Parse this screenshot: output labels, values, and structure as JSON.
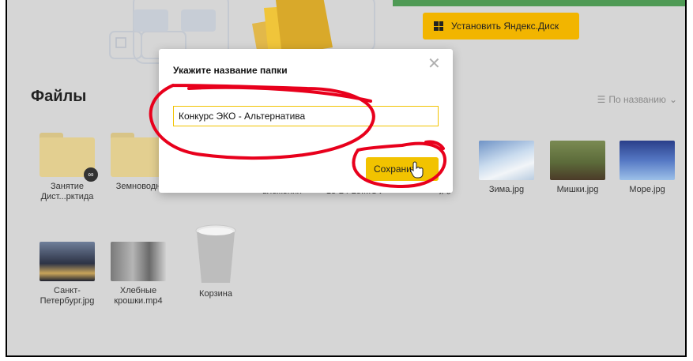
{
  "header": {
    "install_label": "Установить Яндекс.Диск"
  },
  "files_title": "Файлы",
  "sort_label": "По названию",
  "modal": {
    "title": "Укажите название папки",
    "input_value": "Конкурс ЭКО - Альтернатива",
    "save_label": "Сохранить"
  },
  "row1": [
    {
      "label": "Занятие Дист...рктида"
    },
    {
      "label": "Земноводн"
    },
    {
      "label": "вложения"
    },
    {
      "label": "13-24-25.MOV"
    },
    {
      "label": "...jpg"
    },
    {
      "label": "Зима.jpg"
    },
    {
      "label": "Мишки.jpg"
    },
    {
      "label": "Море.jpg"
    }
  ],
  "row2": [
    {
      "label": "Санкт-Петербург.jpg"
    },
    {
      "label": "Хлебные крошки.mp4"
    },
    {
      "label": "Корзина"
    }
  ],
  "colors": {
    "accent": "#f2c300",
    "folder": "#e3cf90",
    "annotation": "#e8001c"
  }
}
